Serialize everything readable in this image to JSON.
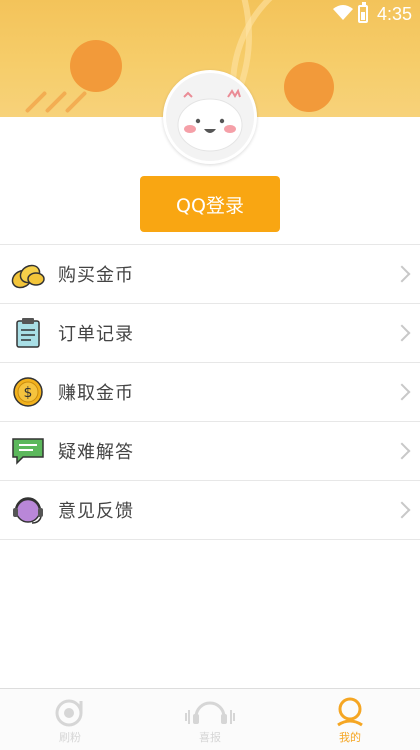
{
  "status_bar": {
    "time": "4:35"
  },
  "header": {
    "login_button_label": "QQ登录"
  },
  "menu": [
    {
      "label": "购买金币",
      "icon": "coins-icon"
    },
    {
      "label": "订单记录",
      "icon": "clipboard-icon"
    },
    {
      "label": "赚取金币",
      "icon": "dollar-coin-icon"
    },
    {
      "label": "疑难解答",
      "icon": "chat-bubble-icon"
    },
    {
      "label": "意见反馈",
      "icon": "headset-icon"
    }
  ],
  "bottom_nav": [
    {
      "label": "刷粉",
      "icon": "record-icon",
      "active": false
    },
    {
      "label": "喜报",
      "icon": "headphones-icon",
      "active": false
    },
    {
      "label": "我的",
      "icon": "user-icon",
      "active": true
    }
  ],
  "colors": {
    "accent": "#f9a612",
    "banner": "#f6cd6a",
    "active_tab": "#f5a623",
    "inactive_tab": "#d6d6d6"
  }
}
